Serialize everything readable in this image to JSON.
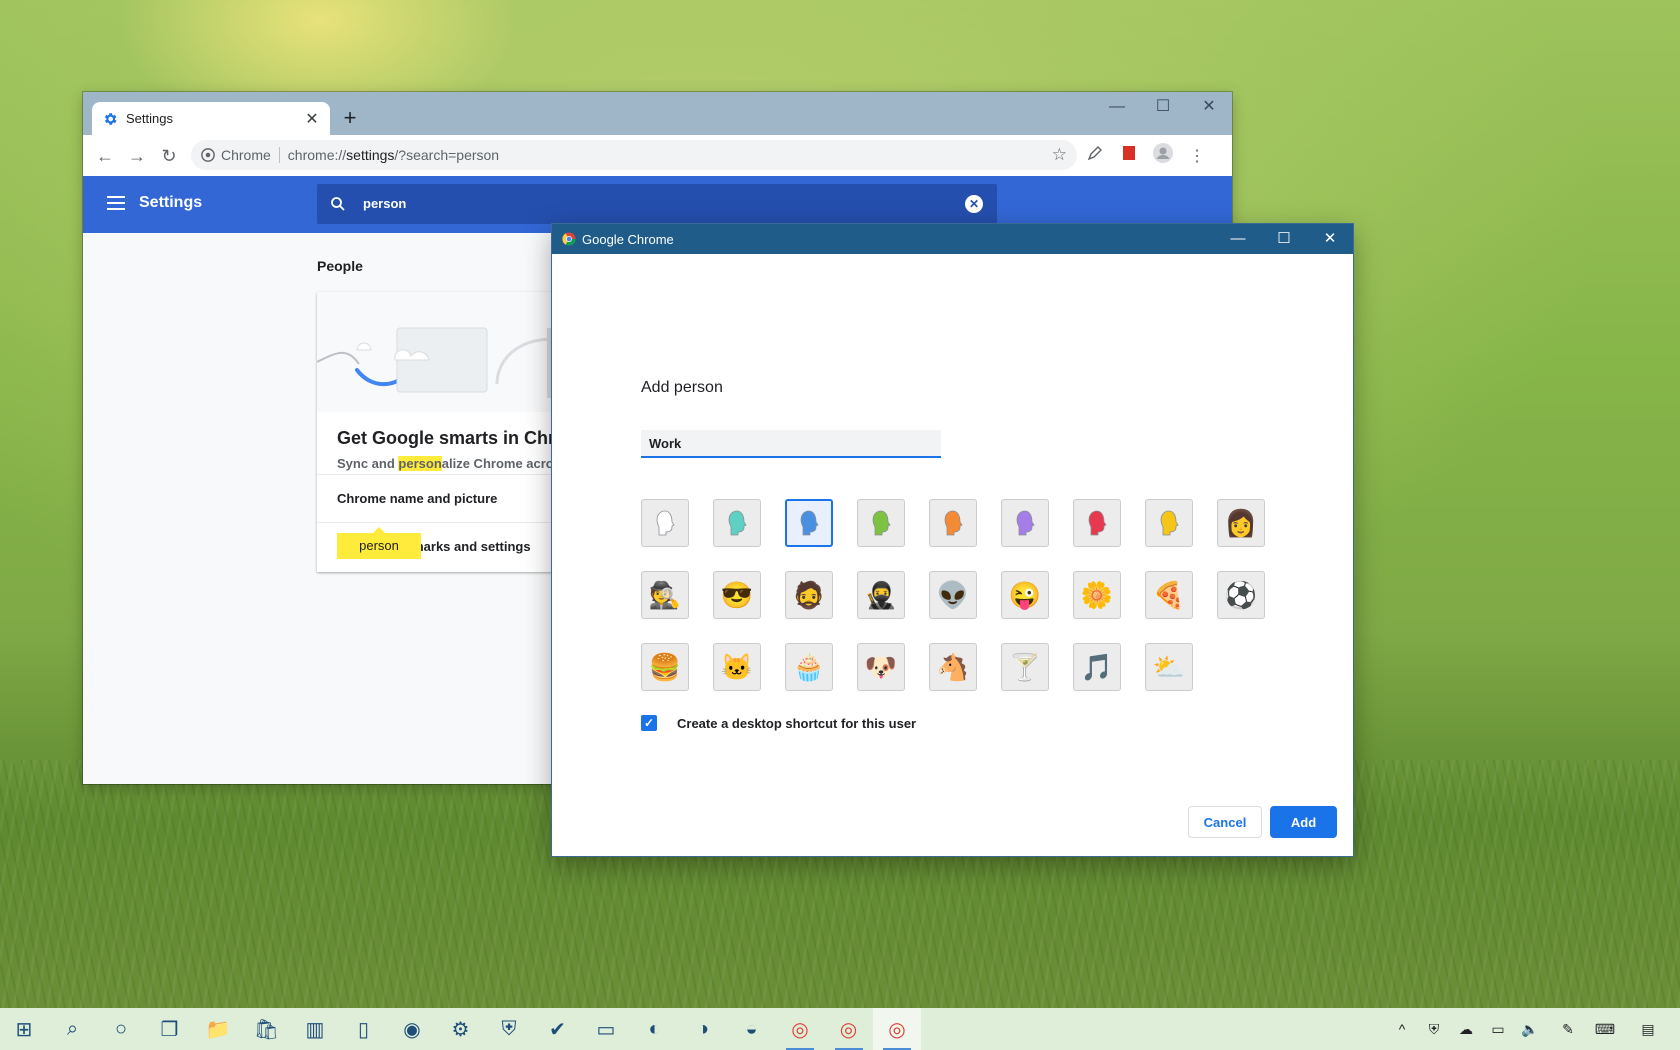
{
  "browser": {
    "tab_title": "Settings",
    "omnibox": {
      "origin": "Chrome",
      "url_prefix": "chrome://",
      "url_host": "settings",
      "url_path": "/?search=person"
    },
    "settings_title": "Settings",
    "search_value": "person",
    "people_heading": "People",
    "promo_title": "Get Google smarts in Chrome",
    "promo_sub_before": "Sync and ",
    "promo_sub_highlight": "person",
    "promo_sub_after": "alize Chrome across your devices",
    "row_name_picture": "Chrome name and picture",
    "row_import": "Import bookmarks and settings",
    "tooltip": "person"
  },
  "dialog": {
    "title": "Google Chrome",
    "heading": "Add person",
    "name_value": "Work",
    "shortcut_label": "Create a desktop shortcut for this user",
    "shortcut_checked": true,
    "cancel_label": "Cancel",
    "add_label": "Add",
    "avatars": [
      {
        "name": "avatar-white-head",
        "kind": "head",
        "color": "#ffffff"
      },
      {
        "name": "avatar-teal-head",
        "kind": "head",
        "color": "#5ed1c4"
      },
      {
        "name": "avatar-blue-head",
        "kind": "head",
        "color": "#4a90e2",
        "selected": true
      },
      {
        "name": "avatar-green-head",
        "kind": "head",
        "color": "#7cc243"
      },
      {
        "name": "avatar-orange-head",
        "kind": "head",
        "color": "#f58a35"
      },
      {
        "name": "avatar-purple-head",
        "kind": "head",
        "color": "#a57de8"
      },
      {
        "name": "avatar-red-head",
        "kind": "head",
        "color": "#e8384f"
      },
      {
        "name": "avatar-yellow-head",
        "kind": "head",
        "color": "#f5c518"
      },
      {
        "name": "avatar-blonde-woman",
        "kind": "emoji",
        "glyph": "👩"
      },
      {
        "name": "avatar-spy-man",
        "kind": "emoji",
        "glyph": "🕵"
      },
      {
        "name": "avatar-woman-sunglasses",
        "kind": "emoji",
        "glyph": "😎"
      },
      {
        "name": "avatar-businessman",
        "kind": "emoji",
        "glyph": "🧔"
      },
      {
        "name": "avatar-ninja",
        "kind": "emoji",
        "glyph": "🥷"
      },
      {
        "name": "avatar-alien",
        "kind": "emoji",
        "glyph": "👽"
      },
      {
        "name": "avatar-smiley",
        "kind": "emoji",
        "glyph": "😜"
      },
      {
        "name": "avatar-flower",
        "kind": "emoji",
        "glyph": "🌼"
      },
      {
        "name": "avatar-pizza",
        "kind": "emoji",
        "glyph": "🍕"
      },
      {
        "name": "avatar-soccer-ball",
        "kind": "emoji",
        "glyph": "⚽"
      },
      {
        "name": "avatar-burger",
        "kind": "emoji",
        "glyph": "🍔"
      },
      {
        "name": "avatar-cat",
        "kind": "emoji",
        "glyph": "🐱"
      },
      {
        "name": "avatar-cupcake",
        "kind": "emoji",
        "glyph": "🧁"
      },
      {
        "name": "avatar-dog",
        "kind": "emoji",
        "glyph": "🐶"
      },
      {
        "name": "avatar-horse",
        "kind": "emoji",
        "glyph": "🐴"
      },
      {
        "name": "avatar-cocktail",
        "kind": "emoji",
        "glyph": "🍸"
      },
      {
        "name": "avatar-music-note",
        "kind": "emoji",
        "glyph": "🎵"
      },
      {
        "name": "avatar-sun-cloud",
        "kind": "emoji",
        "glyph": "⛅"
      }
    ]
  },
  "colors": {
    "accent": "#1a73e8",
    "settings_header": "#3367d6",
    "dialog_titlebar": "#1f5c8a"
  },
  "taskbar": {
    "apps": [
      {
        "name": "start-icon"
      },
      {
        "name": "search-icon"
      },
      {
        "name": "cortana-icon"
      },
      {
        "name": "task-view-icon"
      },
      {
        "name": "file-explorer-icon"
      },
      {
        "name": "store-icon"
      },
      {
        "name": "app-stripes-icon"
      },
      {
        "name": "phone-icon"
      },
      {
        "name": "photos-icon"
      },
      {
        "name": "settings-icon"
      },
      {
        "name": "security-icon"
      },
      {
        "name": "todo-icon"
      },
      {
        "name": "terminal-icon"
      },
      {
        "name": "edge-icon"
      },
      {
        "name": "edge-canary-icon"
      },
      {
        "name": "edge-dev-icon"
      },
      {
        "name": "chrome-icon"
      },
      {
        "name": "chrome-profile-icon"
      },
      {
        "name": "chrome-active-icon"
      }
    ]
  }
}
